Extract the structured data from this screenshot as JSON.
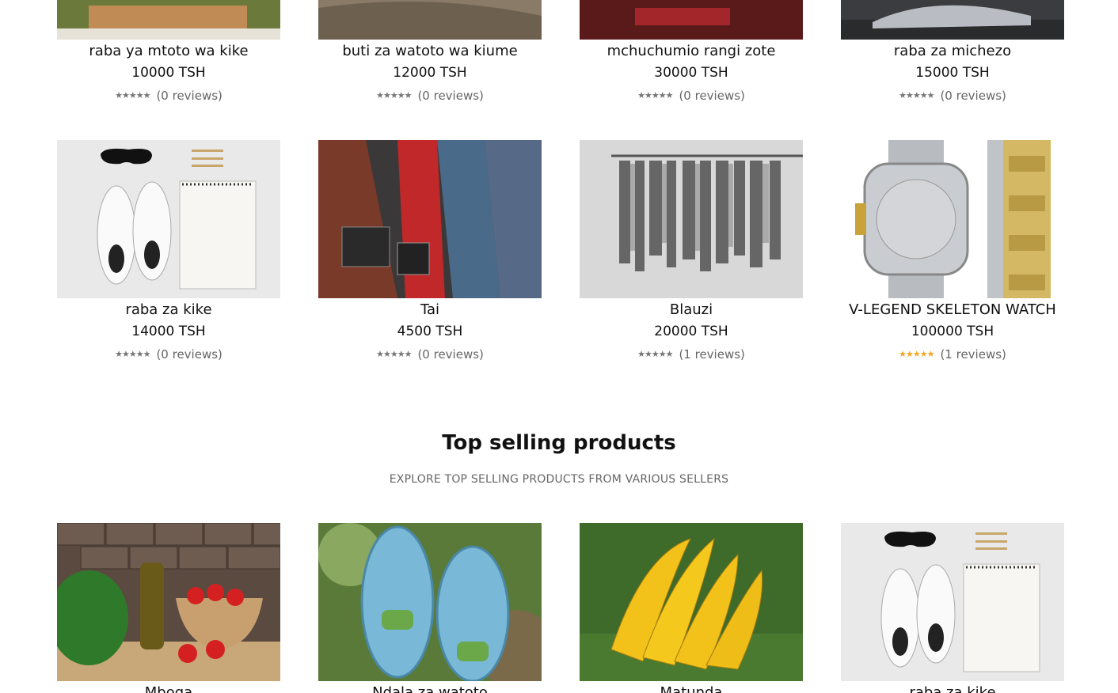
{
  "row1": [
    {
      "name": "raba ya mtoto wa kike",
      "price": "10000 TSH",
      "reviews": "(0 reviews)",
      "image": "its-a-girl-blocks-image",
      "rated": false
    },
    {
      "name": "buti za watoto wa kiume",
      "price": "12000 TSH",
      "reviews": "(0 reviews)",
      "image": "boots-image",
      "rated": false
    },
    {
      "name": "mchuchumio rangi zote",
      "price": "30000 TSH",
      "reviews": "(0 reviews)",
      "image": "red-heels-image",
      "rated": false
    },
    {
      "name": "raba za michezo",
      "price": "15000 TSH",
      "reviews": "(0 reviews)",
      "image": "sport-sneaker-image",
      "rated": false
    }
  ],
  "row2": [
    {
      "name": "raba za kike",
      "price": "14000 TSH",
      "reviews": "(0 reviews)",
      "image": "white-sneakers-notepad-image",
      "rated": false
    },
    {
      "name": "Tai",
      "price": "4500 TSH",
      "reviews": "(0 reviews)",
      "image": "ties-cufflinks-image",
      "rated": false
    },
    {
      "name": "Blauzi",
      "price": "20000 TSH",
      "reviews": "(1 reviews)",
      "image": "clothes-rack-image",
      "rated": false
    },
    {
      "name": "V-LEGEND SKELETON WATCH",
      "price": "100000 TSH",
      "reviews": "(1 reviews)",
      "image": "watch-image",
      "rated": true
    }
  ],
  "section": {
    "title": "Top selling products",
    "subtitle": "EXPLORE TOP SELLING PRODUCTS FROM VARIOUS SELLERS"
  },
  "row3": [
    {
      "name": "Mboga",
      "image": "vegetables-oil-image"
    },
    {
      "name": "Ndala za watoto",
      "image": "blue-slippers-image"
    },
    {
      "name": "Matunda",
      "image": "bananas-image"
    },
    {
      "name": "raba za kike",
      "image": "white-sneakers-notepad-image"
    }
  ],
  "stars": "★★★★★",
  "colors": {
    "star_gray": "#777777",
    "star_gold": "#f5a623",
    "text": "#111111",
    "muted": "#666666"
  }
}
